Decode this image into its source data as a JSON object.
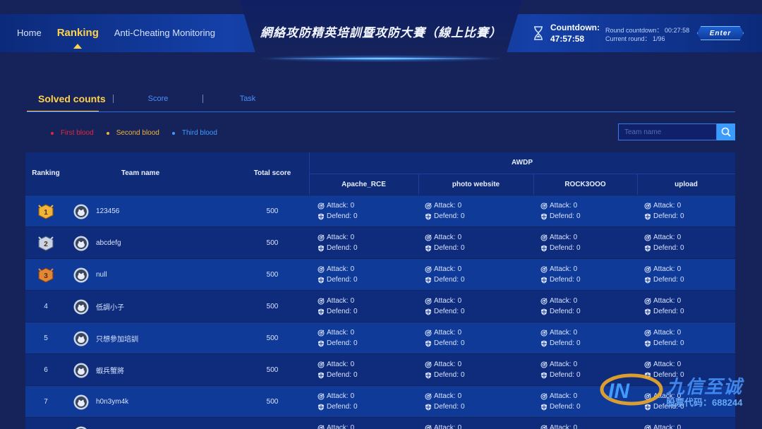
{
  "header": {
    "nav": [
      {
        "label": "Home",
        "active": false
      },
      {
        "label": "Ranking",
        "active": true
      },
      {
        "label": "Anti-Cheating Monitoring",
        "active": false
      }
    ],
    "title": "網絡攻防精英培訓暨攻防大賽（線上比賽）",
    "countdown_label": "Countdown:",
    "countdown_time": "47:57:58",
    "round_countdown": "Round countdown：  00:27:58",
    "current_round": "Current round：  1/96",
    "enter_label": "Enter"
  },
  "tabs": [
    {
      "label": "Solved counts",
      "active": true
    },
    {
      "label": "Score",
      "active": false
    },
    {
      "label": "Task",
      "active": false
    }
  ],
  "legend": [
    {
      "label": "First blood",
      "color": "#e0283a"
    },
    {
      "label": "Second blood",
      "color": "#f2b233"
    },
    {
      "label": "Third blood",
      "color": "#3f9bff"
    }
  ],
  "search": {
    "placeholder": "Team name"
  },
  "table": {
    "col_ranking": "Ranking",
    "col_team": "Team name",
    "col_total": "Total score",
    "group": "AWDP",
    "challenges": [
      "Apache_RCE",
      "photo website",
      "ROCK3OOO",
      "upload"
    ],
    "attack_label": "Attack:",
    "defend_label": "Defend:",
    "rows": [
      {
        "rank": "1",
        "team": "123456",
        "score": "500",
        "attack": [
          "0",
          "0",
          "0",
          "0"
        ],
        "defend": [
          "0",
          "0",
          "0",
          "0"
        ]
      },
      {
        "rank": "2",
        "team": "abcdefg",
        "score": "500",
        "attack": [
          "0",
          "0",
          "0",
          "0"
        ],
        "defend": [
          "0",
          "0",
          "0",
          "0"
        ]
      },
      {
        "rank": "3",
        "team": "null",
        "score": "500",
        "attack": [
          "0",
          "0",
          "0",
          "0"
        ],
        "defend": [
          "0",
          "0",
          "0",
          "0"
        ]
      },
      {
        "rank": "4",
        "team": "低調小子",
        "score": "500",
        "attack": [
          "0",
          "0",
          "0",
          "0"
        ],
        "defend": [
          "0",
          "0",
          "0",
          "0"
        ]
      },
      {
        "rank": "5",
        "team": "只想參加培訓",
        "score": "500",
        "attack": [
          "0",
          "0",
          "0",
          "0"
        ],
        "defend": [
          "0",
          "0",
          "0",
          "0"
        ]
      },
      {
        "rank": "6",
        "team": "蝦兵蟹將",
        "score": "500",
        "attack": [
          "0",
          "0",
          "0",
          "0"
        ],
        "defend": [
          "0",
          "0",
          "0",
          "0"
        ]
      },
      {
        "rank": "7",
        "team": "h0n3ym4k",
        "score": "500",
        "attack": [
          "0",
          "0",
          "0",
          "0"
        ],
        "defend": [
          "0",
          "0",
          "0",
          "0"
        ]
      },
      {
        "rank": "",
        "team": "",
        "score": "",
        "attack": [
          "0",
          "0",
          "0",
          "0"
        ],
        "defend": [
          "",
          "",
          "",
          ""
        ]
      }
    ]
  },
  "watermark": {
    "text": "九信至诚",
    "sub": "股票代码：688244"
  }
}
